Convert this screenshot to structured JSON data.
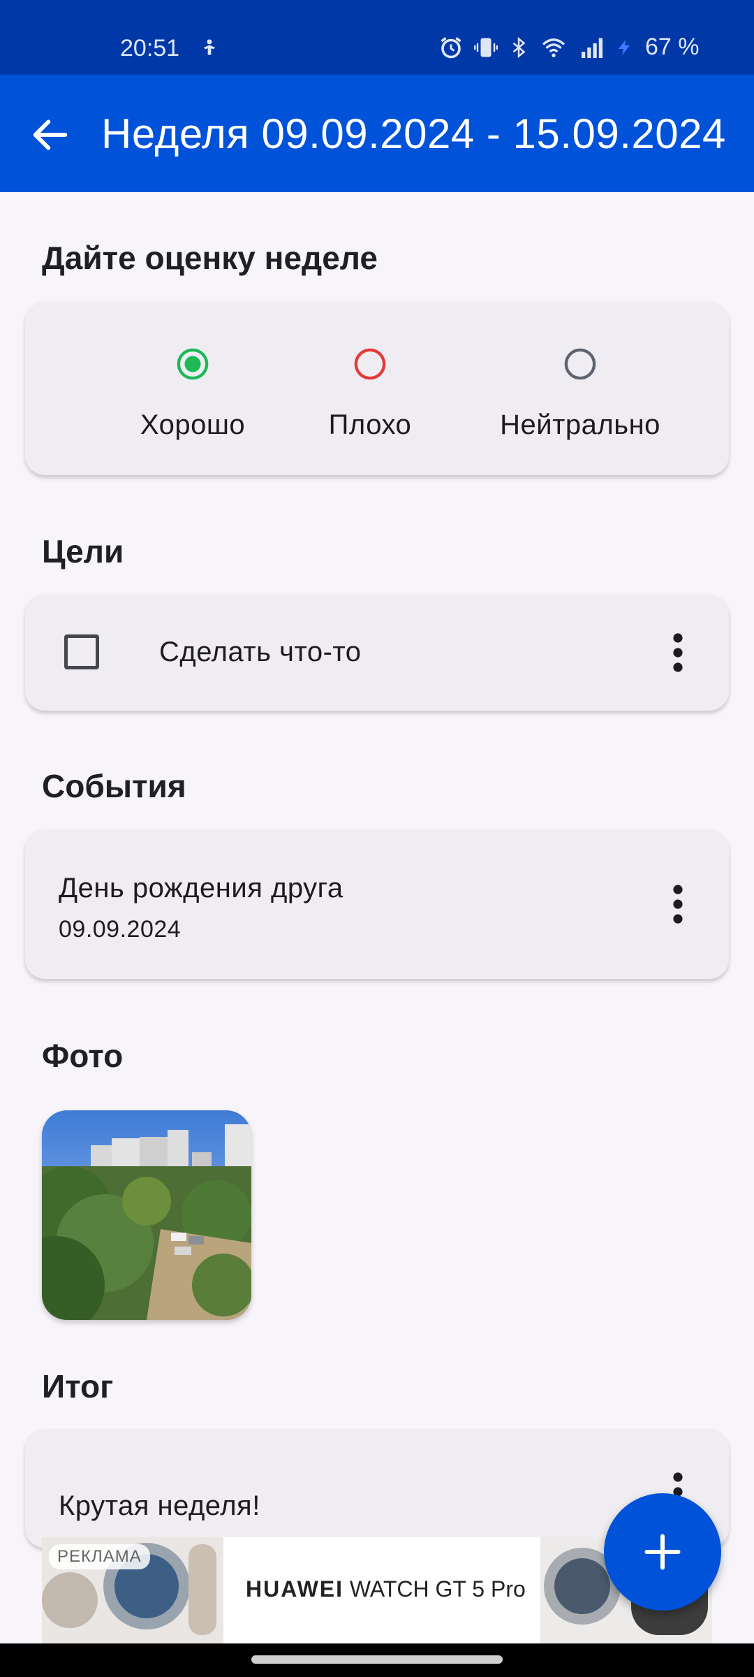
{
  "status_bar": {
    "time": "20:51",
    "battery": "67 %",
    "icons": [
      "person-icon",
      "alarm-icon",
      "vibrate-icon",
      "bluetooth-icon",
      "wifi-icon",
      "signal-icon",
      "charging-icon"
    ]
  },
  "app_bar": {
    "back_icon": "arrow-back-icon",
    "title": "Неделя 09.09.2024 - 15.09.2024",
    "color": "#0052d9"
  },
  "rating": {
    "title": "Дайте оценку неделе",
    "options": [
      {
        "label": "Хорошо",
        "selected": true,
        "color": "#1db954"
      },
      {
        "label": "Плохо",
        "selected": false,
        "color": "#e53935"
      },
      {
        "label": "Нейтрально",
        "selected": false,
        "color": "#5f6270"
      }
    ]
  },
  "goals": {
    "title": "Цели",
    "items": [
      {
        "text": "Сделать что-то",
        "checked": false
      }
    ]
  },
  "events": {
    "title": "События",
    "items": [
      {
        "title": "День рождения друга",
        "date": "09.09.2024"
      }
    ]
  },
  "photos": {
    "title": "Фото"
  },
  "summary": {
    "title": "Итог",
    "text": "Крутая неделя!"
  },
  "ad": {
    "badge": "РЕКЛАМА",
    "brand": "HUAWEI",
    "product": "WATCH GT 5 Pro"
  },
  "fab": {
    "icon": "plus-icon"
  }
}
